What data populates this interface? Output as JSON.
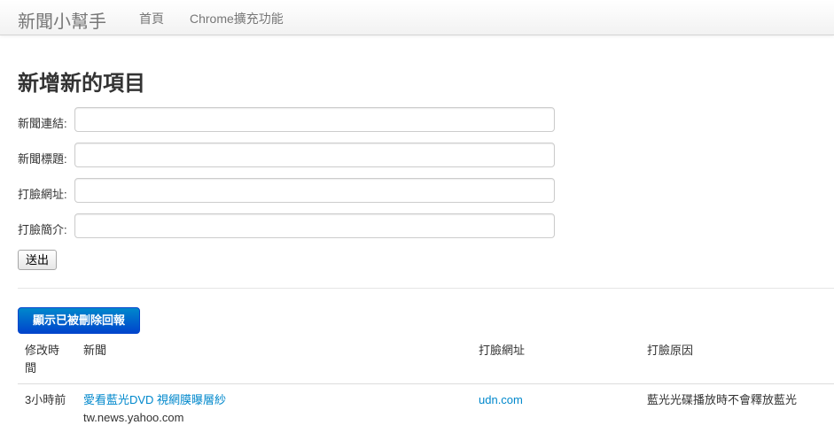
{
  "navbar": {
    "brand": "新聞小幫手",
    "links": [
      "首頁",
      "Chrome擴充功能"
    ]
  },
  "form": {
    "title": "新增新的項目",
    "fields": [
      {
        "label": "新聞連結:",
        "value": ""
      },
      {
        "label": "新聞標題:",
        "value": ""
      },
      {
        "label": "打臉網址:",
        "value": ""
      },
      {
        "label": "打臉簡介:",
        "value": ""
      }
    ],
    "submit_label": "送出"
  },
  "reports": {
    "show_deleted_label": "顯示已被刪除回報",
    "columns": [
      "修改時間",
      "新聞",
      "打臉網址",
      "打臉原因"
    ],
    "rows": [
      {
        "time": "3小時前",
        "news_title": "愛看藍光DVD 視網膜曝層紗",
        "news_domain": "tw.news.yahoo.com",
        "rebuttal_url": "udn.com",
        "reason": "藍光光碟播放時不會釋放藍光"
      }
    ]
  }
}
